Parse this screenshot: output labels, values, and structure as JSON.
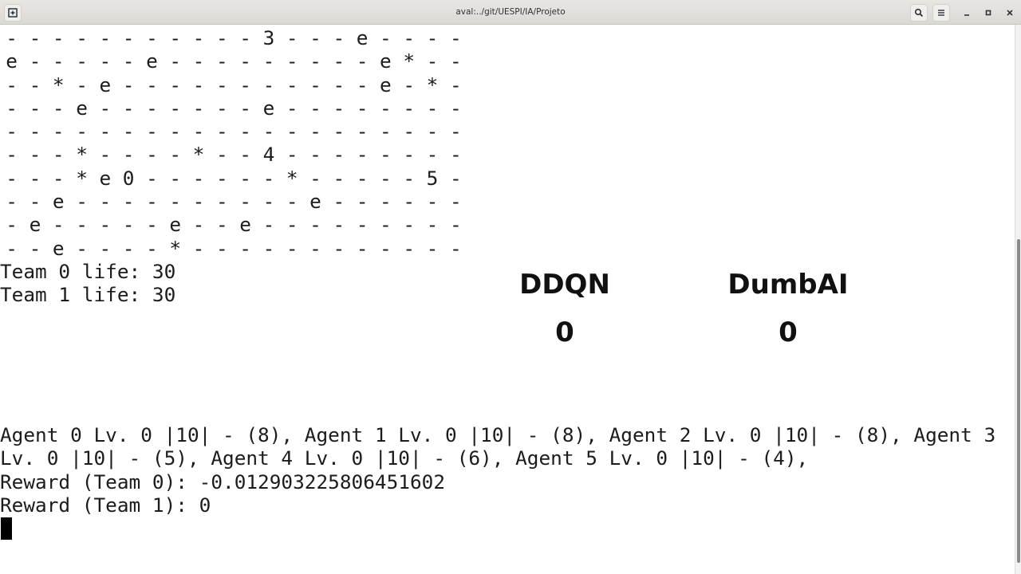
{
  "window": {
    "title": "aval:../git/UESPI/IA/Projeto",
    "icons": {
      "new_tab": "new-tab-icon",
      "search": "search-icon",
      "menu": "hamburger-menu-icon",
      "minimize": "minimize-icon",
      "maximize": "maximize-icon",
      "close": "close-icon"
    }
  },
  "board": {
    "rows": [
      [
        "-",
        "-",
        "-",
        "-",
        "-",
        "-",
        "-",
        "-",
        "-",
        "-",
        "-",
        "3",
        "-",
        "-",
        "-",
        "e",
        "-",
        "-",
        "-",
        "-"
      ],
      [
        "e",
        "-",
        "-",
        "-",
        "-",
        "-",
        "e",
        "-",
        "-",
        "-",
        "-",
        "-",
        "-",
        "-",
        "-",
        "-",
        "e",
        "*",
        "-",
        "-"
      ],
      [
        "-",
        "-",
        "*",
        "-",
        "e",
        "-",
        "-",
        "-",
        "-",
        "-",
        "-",
        "-",
        "-",
        "-",
        "-",
        "-",
        "e",
        "-",
        "*",
        "-"
      ],
      [
        "-",
        "-",
        "-",
        "e",
        "-",
        "-",
        "-",
        "-",
        "-",
        "-",
        "-",
        "e",
        "-",
        "-",
        "-",
        "-",
        "-",
        "-",
        "-",
        "-"
      ],
      [
        "-",
        "-",
        "-",
        "-",
        "-",
        "-",
        "-",
        "-",
        "-",
        "-",
        "-",
        "-",
        "-",
        "-",
        "-",
        "-",
        "-",
        "-",
        "-",
        "-"
      ],
      [
        "-",
        "-",
        "-",
        "*",
        "-",
        "-",
        "-",
        "-",
        "*",
        "-",
        "-",
        "4",
        "-",
        "-",
        "-",
        "-",
        "-",
        "-",
        "-",
        "-"
      ],
      [
        "-",
        "-",
        "-",
        "*",
        "e",
        "0",
        "-",
        "-",
        "-",
        "-",
        "-",
        "-",
        "*",
        "-",
        "-",
        "-",
        "-",
        "-",
        "5",
        "-"
      ],
      [
        "-",
        "-",
        "e",
        "-",
        "-",
        "-",
        "-",
        "-",
        "-",
        "-",
        "-",
        "-",
        "-",
        "e",
        "-",
        "-",
        "-",
        "-",
        "-",
        "-"
      ],
      [
        "-",
        "e",
        "-",
        "-",
        "-",
        "-",
        "-",
        "e",
        "-",
        "-",
        "e",
        "-",
        "-",
        "-",
        "-",
        "-",
        "-",
        "-",
        "-",
        "-"
      ],
      [
        "-",
        "-",
        "e",
        "-",
        "-",
        "-",
        "-",
        "*",
        "-",
        "-",
        "-",
        "-",
        "-",
        "-",
        "-",
        "-",
        "-",
        "-",
        "-",
        "-"
      ]
    ]
  },
  "status": {
    "team0_life": "Team 0 life: 30",
    "team1_life": "Team 1 life: 30"
  },
  "scoreboard": {
    "left_name": "DDQN",
    "left_score": "0",
    "right_name": "DumbAI",
    "right_score": "0"
  },
  "log": {
    "agents_line1": "Agent 0 Lv. 0 |10| - (8), Agent 1 Lv. 0 |10| - (8), Agent 2 Lv. 0 |10| - (8), Agent 3",
    "agents_line2": "Lv. 0 |10| - (5), Agent 4 Lv. 0 |10| - (6), Agent 5 Lv. 0 |10| - (4),",
    "reward_team0": "Reward (Team 0): -0.012903225806451602",
    "reward_team1": "Reward (Team 1): 0"
  },
  "scrollbar": {
    "position_fraction": 0.39,
    "visible_fraction": 0.59
  }
}
